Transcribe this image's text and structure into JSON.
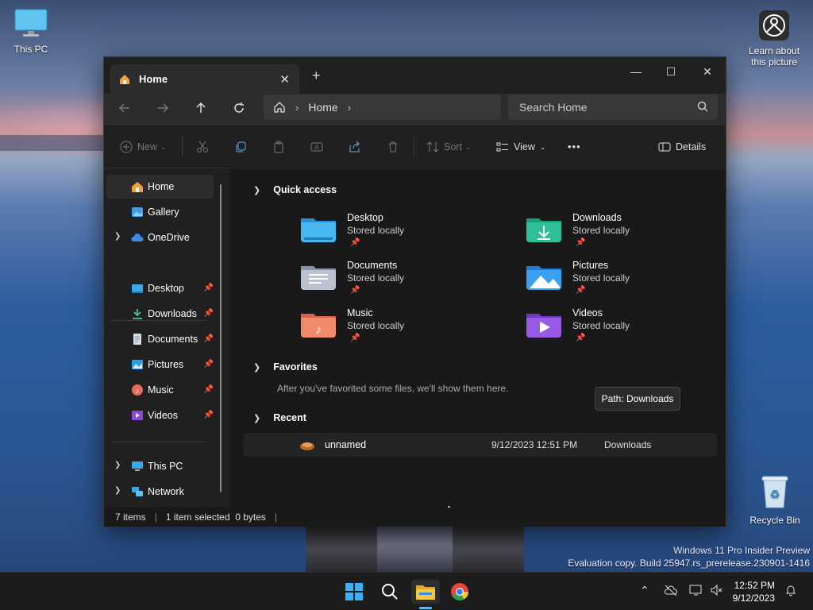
{
  "desktop": {
    "this_pc_label": "This PC",
    "learn_label_1": "Learn about",
    "learn_label_2": "this picture",
    "recycle_label": "Recycle Bin",
    "watermark_line1": "Windows 11 Pro Insider Preview",
    "watermark_line2": "Evaluation copy. Build 25947.rs_prerelease.230901-1416"
  },
  "window": {
    "tab_title": "Home",
    "close_glyph": "✕",
    "newtab_glyph": "+",
    "minimize_glyph": "—",
    "maximize_glyph": "☐",
    "window_close_glyph": "✕"
  },
  "address": {
    "crumb": "Home",
    "search_placeholder": "Search Home"
  },
  "commands": {
    "new_label": "New",
    "sort_label": "Sort",
    "view_label": "View",
    "more_label": "•••",
    "details_label": "Details"
  },
  "nav": {
    "items": [
      {
        "label": "Home"
      },
      {
        "label": "Gallery"
      },
      {
        "label": "OneDrive"
      },
      {
        "label": "Desktop"
      },
      {
        "label": "Downloads"
      },
      {
        "label": "Documents"
      },
      {
        "label": "Pictures"
      },
      {
        "label": "Music"
      },
      {
        "label": "Videos"
      },
      {
        "label": "This PC"
      },
      {
        "label": "Network"
      }
    ]
  },
  "quick_access": {
    "title": "Quick access",
    "folders": [
      {
        "name": "Desktop",
        "sub": "Stored locally"
      },
      {
        "name": "Downloads",
        "sub": "Stored locally"
      },
      {
        "name": "Documents",
        "sub": "Stored locally"
      },
      {
        "name": "Pictures",
        "sub": "Stored locally"
      },
      {
        "name": "Music",
        "sub": "Stored locally"
      },
      {
        "name": "Videos",
        "sub": "Stored locally"
      }
    ]
  },
  "favorites": {
    "title": "Favorites",
    "empty_text": "After you've favorited some files, we'll show them here."
  },
  "recent": {
    "title": "Recent",
    "rows": [
      {
        "name": "unnamed",
        "date": "9/12/2023 12:51 PM",
        "location": "Downloads"
      }
    ]
  },
  "tooltip": "Path: Downloads",
  "status": {
    "count": "7 items",
    "selection": "1 item selected  0 bytes"
  },
  "taskbar": {
    "time": "12:52 PM",
    "date": "9/12/2023"
  }
}
